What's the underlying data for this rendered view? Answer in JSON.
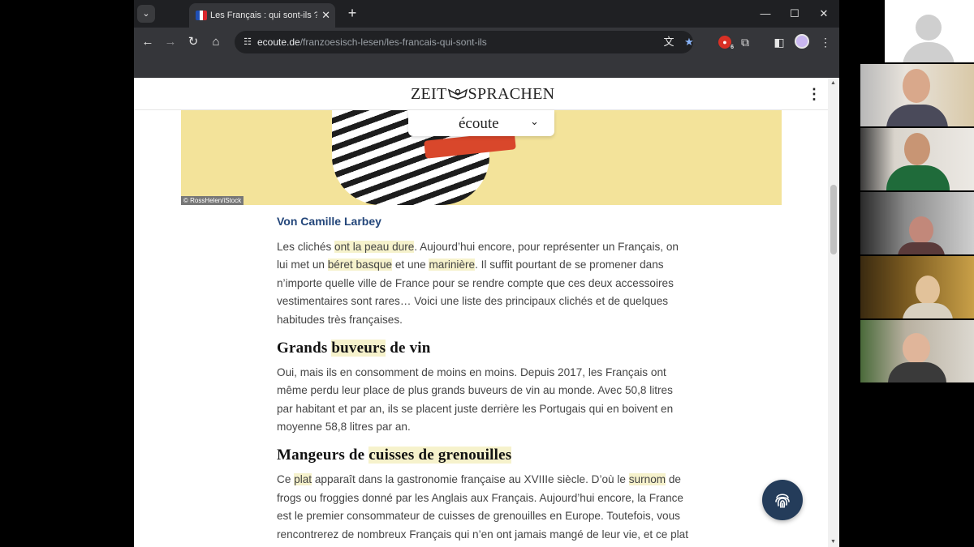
{
  "browser": {
    "active_tab_title": "Les Français : qui sont-ils ? | Éco",
    "new_tab_icon": "plus-icon",
    "url_domain": "ecoute.de",
    "url_path": "/franzoesisch-lesen/les-francais-qui-sont-ils",
    "extension_badge_count": "6"
  },
  "site": {
    "logo_left": "ZEIT",
    "logo_right": "SPRACHEN",
    "dropdown_label": "écoute",
    "image_credit": "© RossHelen/iStock"
  },
  "article": {
    "byline": "Von Camille Larbey",
    "p1": [
      "Les clichés ",
      "ont la peau dure",
      ". Aujourd’hui encore, pour représenter un Français, on lui met un ",
      "béret basque",
      " et une ",
      "marinière",
      ". Il suffit pourtant de se promener dans n’importe quelle ville de France pour se rendre compte que ces deux accessoires vestimentaires sont rares… Voici une liste des principaux clichés et de quelques habitudes très françaises."
    ],
    "h1": [
      "Grands ",
      "buveurs",
      " de vin"
    ],
    "p2": "Oui, mais ils en consomment de moins en moins. Depuis 2017, les Français ont même perdu leur place de plus grands buveurs de vin au monde. Avec 50,8 litres par habitant et par an, ils se placent juste derrière les Portugais qui en boivent en moyenne 58,8 litres par an.",
    "h2": [
      "Mangeurs de ",
      "cuisses de grenouilles"
    ],
    "p3": [
      "Ce ",
      "plat",
      " apparaît dans la gastronomie française au XVIIIe siècle. D’où le ",
      "surnom",
      " de frogs ou froggies donné par les Anglais aux Français. Aujourd’hui encore, la France est le premier consommateur de cuisses de grenouilles en Europe. Toutefois, vous rencontrerez de nombreux Français qui n’en ont jamais mangé de leur vie, et ce plat"
    ]
  },
  "colors": {
    "highlight": "#f6f2cc",
    "byline": "#23467a",
    "fab": "#243c5a",
    "hero_bg": "#f3e39a"
  }
}
